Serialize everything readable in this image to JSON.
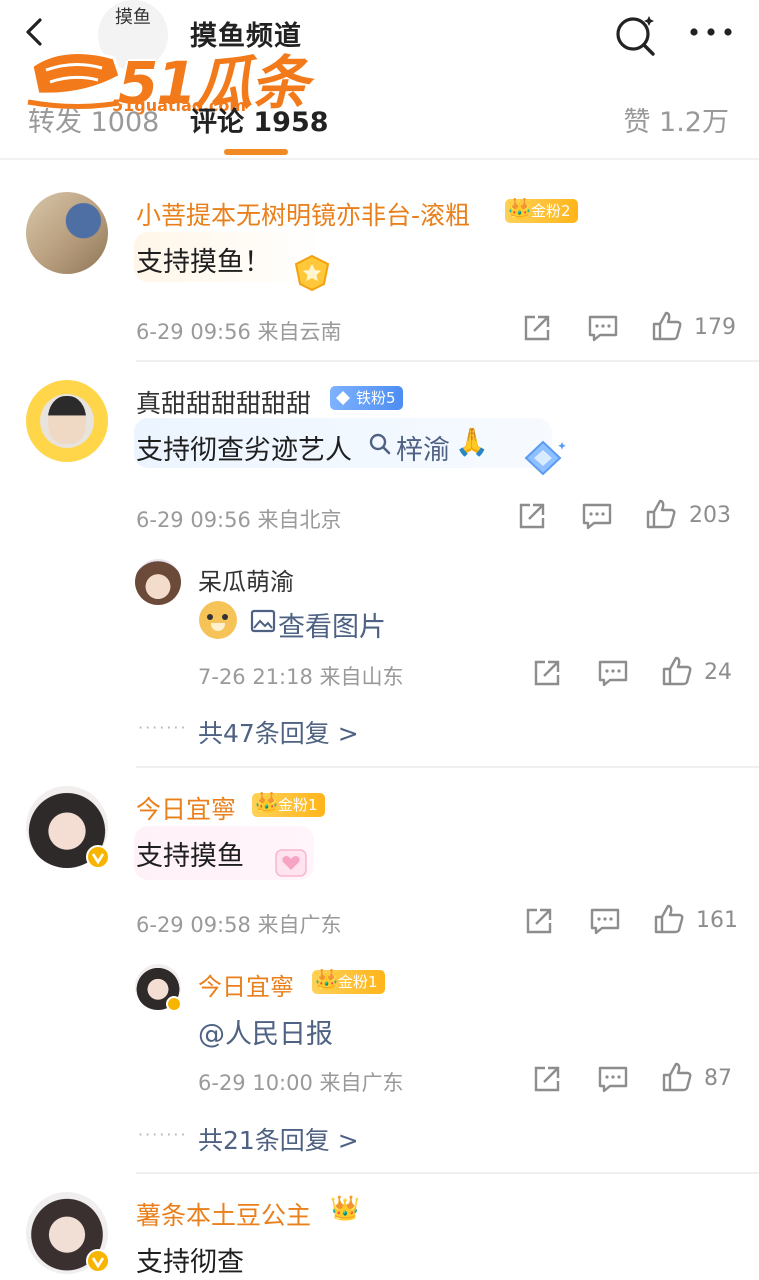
{
  "header": {
    "channel_name": "摸鱼频道",
    "channel_avatar_text": "摸鱼"
  },
  "watermark": {
    "brand": "51瓜条",
    "url": "51guatiao.com"
  },
  "tabs": [
    {
      "label": "转发 1008"
    },
    {
      "label": "评论 1958"
    },
    {
      "label": "赞 1.2万"
    }
  ],
  "comments": [
    {
      "nickname": "小菩提本无树明镜亦非台-滚粗",
      "badge": "金粉2",
      "text": "支持摸鱼！",
      "meta": "6-29 09:56 来自云南",
      "likes": "179"
    },
    {
      "nickname": "真甜甜甜甜甜甜",
      "badge": "铁粉5",
      "text": "支持彻查劣迹艺人",
      "link_text": "梓渝",
      "emoji": "🙏",
      "meta": "6-29 09:56 来自北京",
      "likes": "203",
      "reply": {
        "nickname": "呆瓜萌渝",
        "text": "查看图片",
        "meta": "7-26 21:18 来自山东",
        "likes": "24"
      },
      "more_replies": "共47条回复 >"
    },
    {
      "nickname": "今日宜寧",
      "badge": "金粉1",
      "text": "支持摸鱼",
      "meta": "6-29 09:58 来自广东",
      "likes": "161",
      "reply": {
        "nickname": "今日宜寧",
        "badge": "金粉1",
        "text": "@人民日报",
        "meta": "6-29 10:00 来自广东",
        "likes": "87"
      },
      "more_replies": "共21条回复 >"
    },
    {
      "nickname": "薯条本土豆公主",
      "text": "支持彻查"
    }
  ],
  "colors": {
    "accent": "#f28a24",
    "gold_name": "#e9801c",
    "link": "#4f6283"
  }
}
